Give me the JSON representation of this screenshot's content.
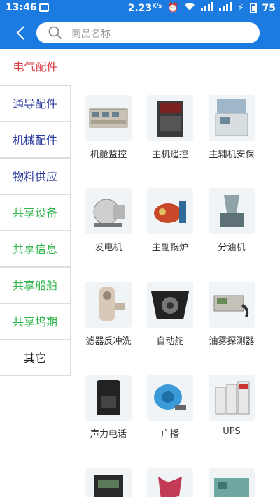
{
  "status_bar": {
    "time": "13:46",
    "speed_value": "2.23",
    "speed_unit": "K/s",
    "battery": "75"
  },
  "header": {
    "search_placeholder": "商品名称"
  },
  "sidebar": {
    "items": [
      {
        "label": "电气配件",
        "state": "active"
      },
      {
        "label": "通导配件"
      },
      {
        "label": "机械配件"
      },
      {
        "label": "物料供应"
      },
      {
        "label": "共享设备"
      },
      {
        "label": "共享信息"
      },
      {
        "label": "共享船舶"
      },
      {
        "label": "共享坞期"
      },
      {
        "label": "其它"
      }
    ]
  },
  "products": [
    {
      "label": "机舱监控"
    },
    {
      "label": "主机遥控"
    },
    {
      "label": "主辅机安保"
    },
    {
      "label": "发电机"
    },
    {
      "label": "主副锅炉"
    },
    {
      "label": "分油机"
    },
    {
      "label": "滤器反冲洗"
    },
    {
      "label": "自动舵"
    },
    {
      "label": "油雾探测器"
    },
    {
      "label": "声力电话"
    },
    {
      "label": "广播"
    },
    {
      "label": "UPS"
    },
    {
      "label": ""
    },
    {
      "label": ""
    },
    {
      "label": ""
    }
  ],
  "colors": {
    "brand_blue": "#1c7be0",
    "active_red": "#d9363e",
    "blue_text": "#2b3c9e",
    "green_text": "#2fb34a"
  }
}
